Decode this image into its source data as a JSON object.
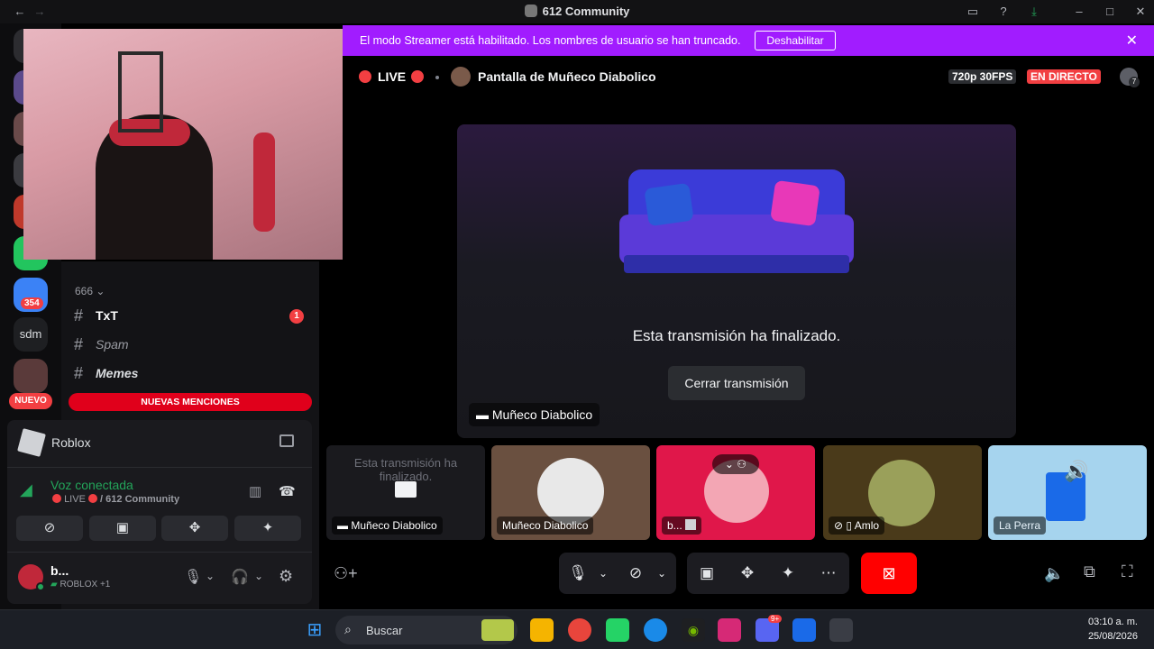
{
  "titlebar": {
    "title": "612 Community"
  },
  "banner": {
    "message": "El modo Streamer está habilitado. Los nombres de usuario se han truncado.",
    "button": "Deshabilitar"
  },
  "stream_header": {
    "live": "LIVE",
    "title": "Pantalla de Muñeco Diabolico",
    "quality": "720p 30FPS",
    "status": "EN DIRECTO",
    "viewers": "7"
  },
  "rail": {
    "badge_count": "354",
    "server_abbr": "sdm",
    "new_badge": "NUEVO"
  },
  "sidebar": {
    "category": "666",
    "channels": [
      {
        "name": "TxT",
        "badge": "1"
      },
      {
        "name": "Spam"
      },
      {
        "name": "Memes"
      }
    ],
    "mentions": "NUEVAS MENCIONES"
  },
  "panel": {
    "activity": "Roblox",
    "voice_status": "Voz conectada",
    "voice_live": "LIVE",
    "voice_server": "/ 612 Community",
    "user_name": "b...",
    "user_status": "ROBLOX +1"
  },
  "stage": {
    "ended_message": "Esta transmisión ha finalizado.",
    "close_button": "Cerrar transmisión",
    "streamer_label": "Muñeco Diabolico"
  },
  "thumbnails": [
    {
      "overlay": "Esta transmisión ha finalizado.",
      "label": "Muñeco Diabolico"
    },
    {
      "label": "Muñeco Diabolico"
    },
    {
      "label": "b..."
    },
    {
      "label": "Amlo"
    },
    {
      "label": "La Perra"
    }
  ],
  "taskbar": {
    "search": "Buscar",
    "time": "03:10 a. m.",
    "date": "25/08/2026",
    "discord_badge": "9+"
  },
  "colors": {
    "banner": "#a11cff",
    "live_red": "#f23f42",
    "voice_green": "#23a55a",
    "end_call": "#f00"
  }
}
